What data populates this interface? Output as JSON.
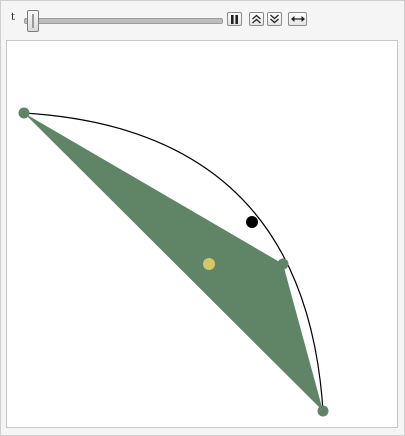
{
  "controls": {
    "parameter_label": "t",
    "slider_value": 0.05,
    "buttons": [
      {
        "name": "pause-button",
        "icon": "pause-icon"
      },
      {
        "name": "faster-button",
        "icon": "double-chevron-up-icon"
      },
      {
        "name": "slower-button",
        "icon": "double-chevron-down-icon"
      },
      {
        "name": "direction-button",
        "icon": "double-arrow-horizontal-icon"
      }
    ]
  },
  "plot": {
    "triangle_color": "#5f8466",
    "centroid_color": "#d6c66a",
    "moving_point_color": "#000000",
    "arc_color": "#000000"
  }
}
